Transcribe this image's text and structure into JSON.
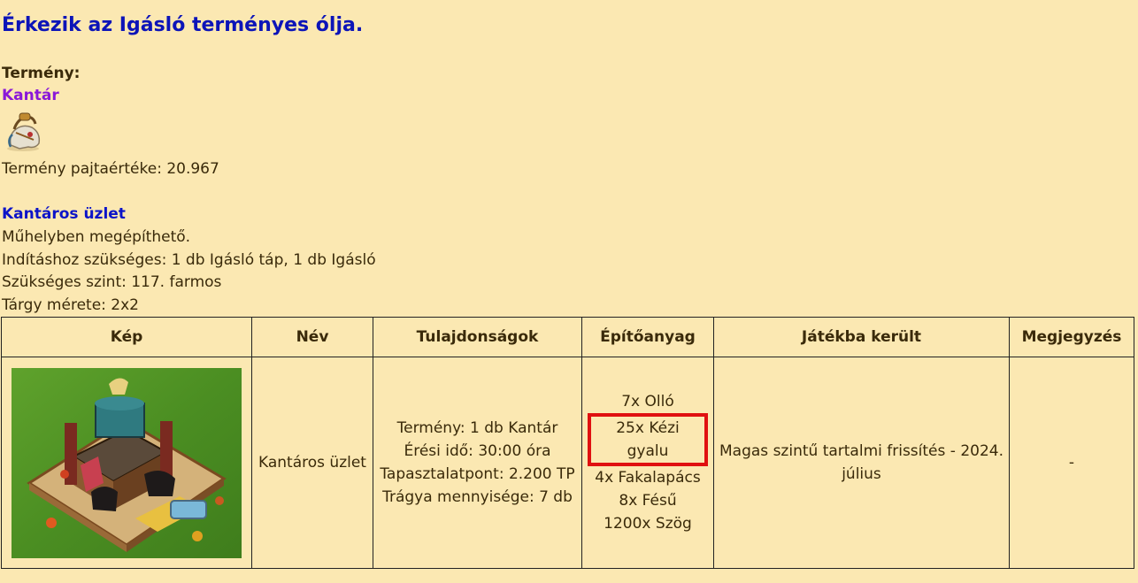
{
  "heading": "Érkezik az Igásló terményes ólja.",
  "crop": {
    "label": "Termény:",
    "name": "Kantár",
    "icon": "bridle-icon",
    "value_line": "Termény pajtaértéke: 20.967"
  },
  "building": {
    "name": "Kantáros üzlet",
    "lines": [
      "Műhelyben megépíthető.",
      "Indításhoz szükséges: 1 db Igásló táp, 1 db Igásló",
      "Szükséges szint: 117. farmos",
      "Tárgy mérete: 2x2"
    ]
  },
  "table": {
    "headers": [
      "Kép",
      "Név",
      "Tulajdonságok",
      "Építőanyag",
      "Játékba került",
      "Megjegyzés"
    ],
    "row": {
      "image_icon": "bridle-shop-building-icon",
      "name": "Kantáros üzlet",
      "properties": [
        "Termény: 1 db Kantár",
        "Érési idő: 30:00 óra",
        "Tapasztalatpont: 2.200 TP",
        "Trágya mennyisége: 7 db"
      ],
      "materials": [
        {
          "text": "7x Olló",
          "highlight": false
        },
        {
          "text": "25x Kézi gyalu",
          "highlight": true
        },
        {
          "text": "4x Fakalapács",
          "highlight": false
        },
        {
          "text": "8x Fésű",
          "highlight": false
        },
        {
          "text": "1200x Szög",
          "highlight": false
        }
      ],
      "added": "Magas szintű tartalmi frissítés - 2024. július",
      "note": "-"
    }
  },
  "colors": {
    "background": "#fbe8b2",
    "heading": "#0c14b8",
    "crop_name": "#8a18d8",
    "building_link": "#0c14c8",
    "highlight_border": "#e01010"
  }
}
